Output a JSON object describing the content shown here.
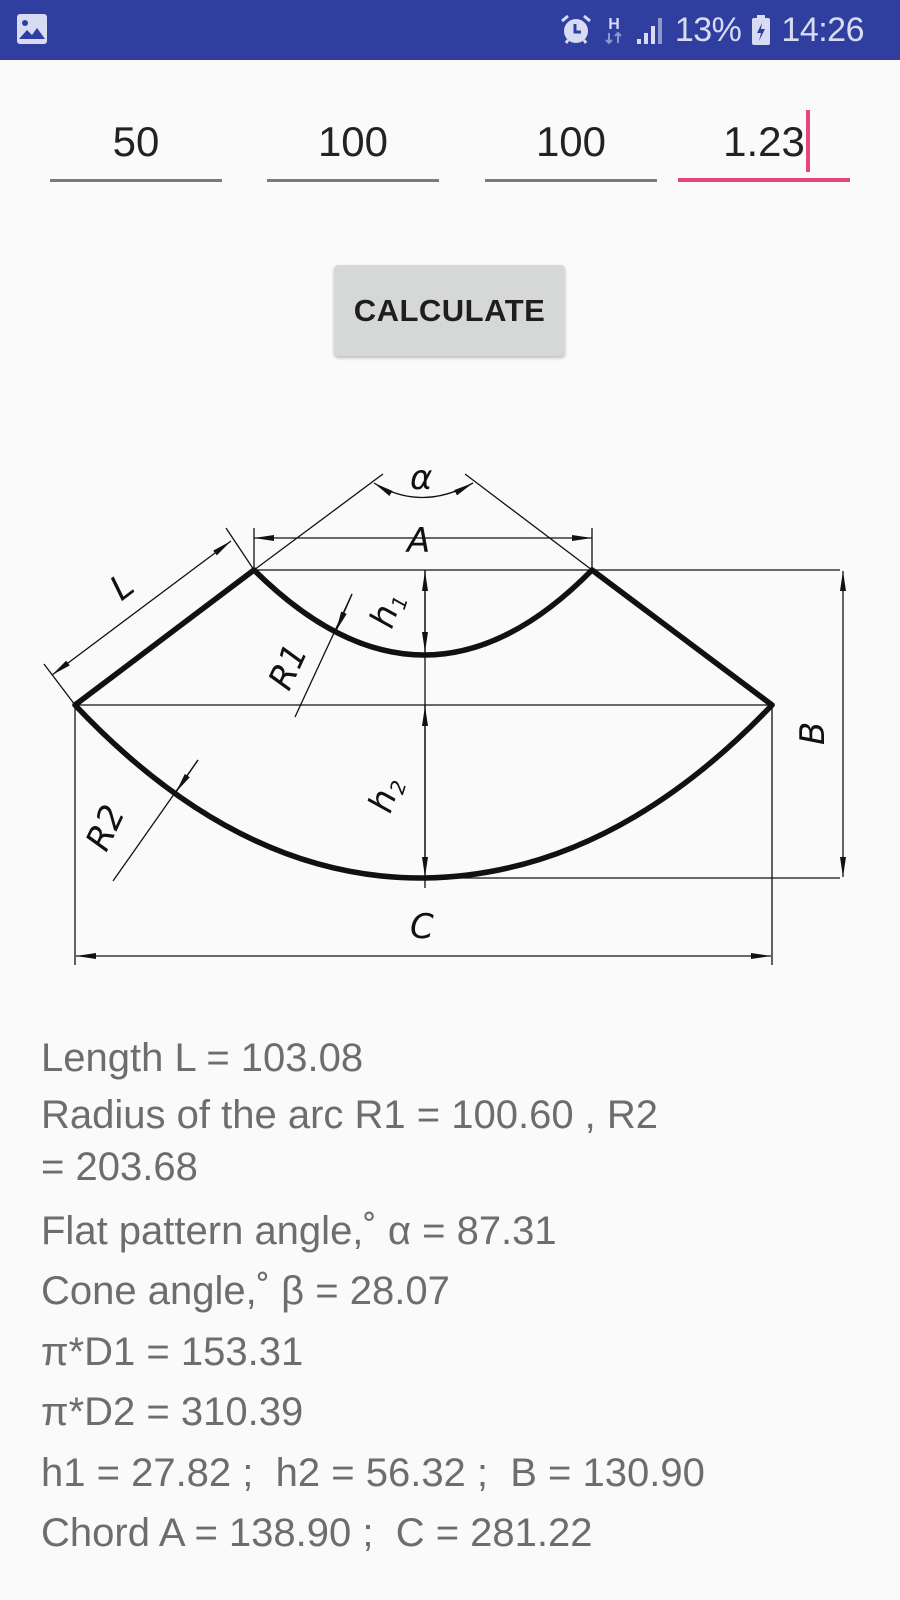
{
  "status_bar": {
    "left_icon": "gallery-icon",
    "icons": [
      "alarm-icon",
      "hspa-data-icon",
      "signal-icon",
      "battery-charging-icon"
    ],
    "network_type": "H",
    "battery_percent": "13%",
    "time": "14:26",
    "background_color": "#303f9f"
  },
  "inputs": [
    {
      "name": "input-1",
      "value": "50"
    },
    {
      "name": "input-2",
      "value": "100"
    },
    {
      "name": "input-3",
      "value": "100"
    },
    {
      "name": "input-4",
      "value": "1.23",
      "focused": true
    }
  ],
  "accent_color": "#e8457c",
  "calculate_button": {
    "label": "CALCULATE"
  },
  "diagram": {
    "labels": {
      "alpha": "α",
      "A": "A",
      "L": "L",
      "h1": "h",
      "h1_sub": "1",
      "R1": "R1",
      "h2": "h",
      "h2_sub": "2",
      "R2": "R2",
      "B": "B",
      "C": "C"
    }
  },
  "results": {
    "length": "Length L = 103.08",
    "radius": "Radius of the arc R1 = 100.60 , R2 = 203.68",
    "flat_angle": "Flat pattern angle,˚ α = 87.31",
    "cone_angle": "Cone angle,˚ β = 28.07",
    "pi_d1": "π*D1 = 153.31",
    "pi_d2": "π*D2 = 310.39",
    "heights": "h1 = 27.82 ;  h2 = 56.32 ;  B = 130.90",
    "chords": "Chord A = 138.90 ;  C = 281.22"
  }
}
